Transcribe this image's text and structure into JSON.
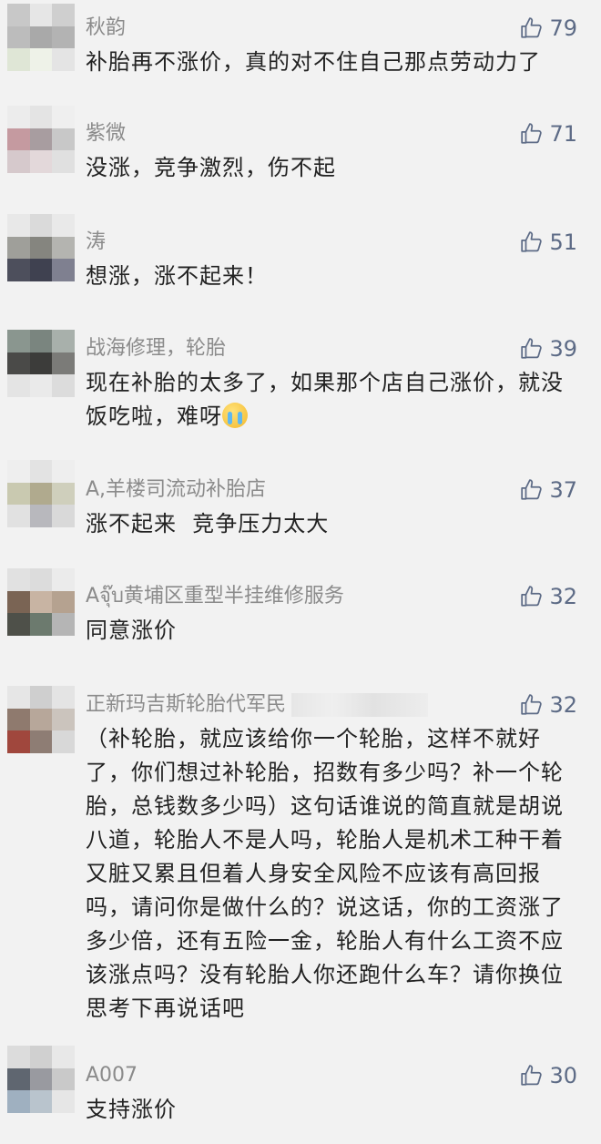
{
  "comments": [
    {
      "name": "秋韵",
      "text": "补胎再不涨价，真的对不住自己那点劳动力了",
      "likes": "79",
      "avatar": [
        "#c8c8c8",
        "#e6e6e6",
        "#cfcfcf",
        "#bcbcbc",
        "#a9a9a9",
        "#b3b3b3",
        "#dfe6d6",
        "#eef2e8",
        "#e4e4e4"
      ]
    },
    {
      "name": "紫微",
      "text": "没涨，竞争激烈，伤不起",
      "likes": "71",
      "avatar": [
        "#ececec",
        "#e4e4e4",
        "#efefef",
        "#c59aa0",
        "#a89da0",
        "#c8c8c8",
        "#d6c9cc",
        "#e3d8da",
        "#e0e0e0"
      ]
    },
    {
      "name": "涛",
      "text": "想涨，涨不起来！",
      "likes": "51",
      "avatar": [
        "#e8e8e8",
        "#dadada",
        "#e9e9e9",
        "#9f9f9a",
        "#85857f",
        "#b4b4b0",
        "#4d4f5c",
        "#3f4150",
        "#7f8090"
      ]
    },
    {
      "name": "战海修理，轮胎",
      "text": "现在补胎的太多了，如果那个店自己涨价，就没饭吃啦，难呀",
      "emoji": "crying-face",
      "likes": "39",
      "avatar": [
        "#8a968f",
        "#7a857f",
        "#a8b0ab",
        "#4a4a48",
        "#3c3c3a",
        "#7b7b78",
        "#e4e4e4",
        "#eaeaea",
        "#dcdcdc"
      ]
    },
    {
      "name": "A,羊楼司流动补胎店",
      "text": "涨不起来  竞争压力太大",
      "likes": "37",
      "avatar": [
        "#eeeeee",
        "#e3e3e3",
        "#eeeeee",
        "#c9c9b0",
        "#b0aa8e",
        "#cfcfbc",
        "#e1e1e1",
        "#b8b8bd",
        "#d9d9d9"
      ]
    },
    {
      "name": "Aจุ๊บ黄埔区重型半挂维修服务",
      "text": "同意涨价",
      "likes": "32",
      "avatar": [
        "#e1e1e1",
        "#dcdcdc",
        "#ebebeb",
        "#7a6454",
        "#c8b4a3",
        "#b5a290",
        "#4e5049",
        "#6c7a6e",
        "#b5b5b5"
      ]
    },
    {
      "name": "正新玛吉斯轮胎代军民",
      "text": "（补轮胎，就应该给你一个轮胎，这样不就好了，你们想过补轮胎，招数有多少吗？补一个轮胎，总钱数多少吗）这句话谁说的简直就是胡说八道，轮胎人不是人吗，轮胎人是机术工种干着又脏又累且但着人身安全风险不应该有高回报吗，请问你是做什么的？说这话，你的工资涨了多少倍，还有五险一金，轮胎人有什么工资不应该涨点吗？没有轮胎人你还跑什么车？请你换位思考下再说话吧",
      "likes": "32",
      "avatar": [
        "#e6e6e6",
        "#cfcfcf",
        "#e4e4e4",
        "#8f7a6e",
        "#b7a79a",
        "#cbc4bd",
        "#a0473d",
        "#8e7d74",
        "#d8d8d8"
      ]
    },
    {
      "name": "A007",
      "text": "支持涨价",
      "likes": "30",
      "avatar": [
        "#dcdcdc",
        "#d0d0d0",
        "#e8e8e8",
        "#5f6670",
        "#999aa0",
        "#c9c9c9",
        "#9fb0c0",
        "#b9c4cd",
        "#e6e6e6"
      ]
    }
  ],
  "colors": {
    "accent": "#5d6b86",
    "name": "#8b8b8b",
    "text": "#222222",
    "background": "#f2f2f2"
  },
  "icons": {
    "like": "thumbs-up-outline-icon"
  }
}
